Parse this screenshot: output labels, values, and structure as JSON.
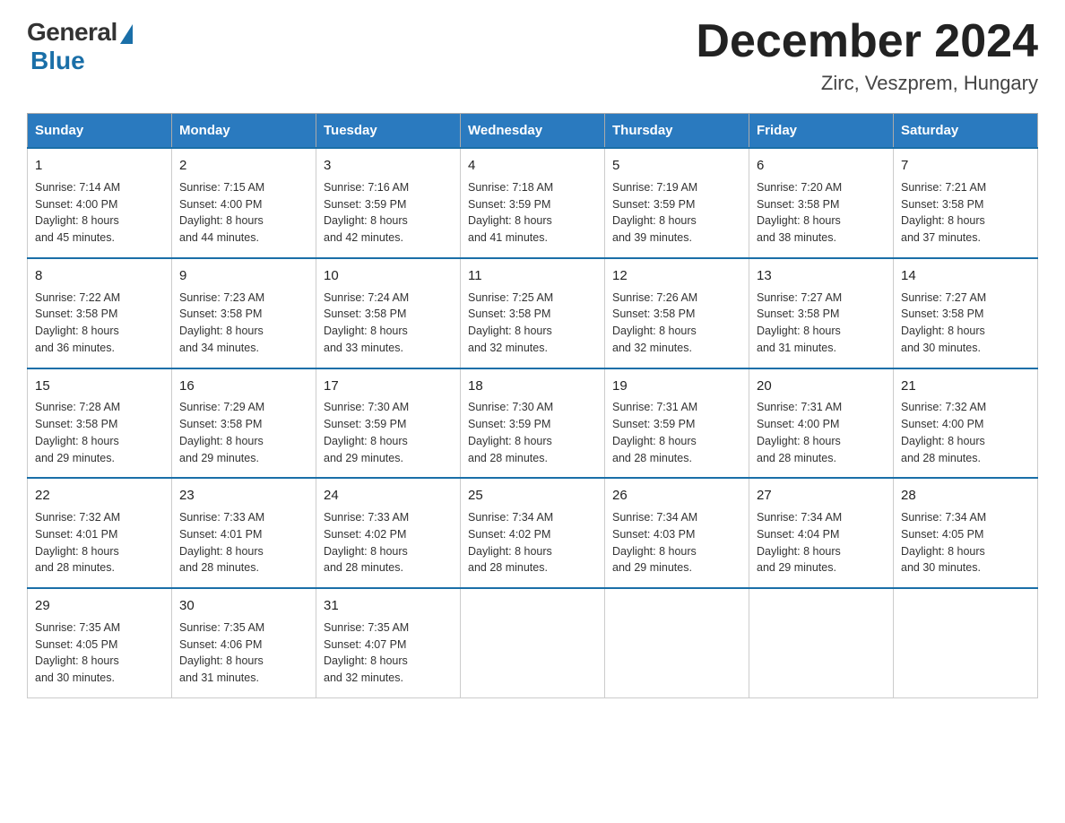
{
  "header": {
    "logo_general": "General",
    "logo_blue": "Blue",
    "month_title": "December 2024",
    "location": "Zirc, Veszprem, Hungary"
  },
  "days_of_week": [
    "Sunday",
    "Monday",
    "Tuesday",
    "Wednesday",
    "Thursday",
    "Friday",
    "Saturday"
  ],
  "weeks": [
    [
      {
        "day": "1",
        "sunrise": "7:14 AM",
        "sunset": "4:00 PM",
        "daylight": "8 hours and 45 minutes."
      },
      {
        "day": "2",
        "sunrise": "7:15 AM",
        "sunset": "4:00 PM",
        "daylight": "8 hours and 44 minutes."
      },
      {
        "day": "3",
        "sunrise": "7:16 AM",
        "sunset": "3:59 PM",
        "daylight": "8 hours and 42 minutes."
      },
      {
        "day": "4",
        "sunrise": "7:18 AM",
        "sunset": "3:59 PM",
        "daylight": "8 hours and 41 minutes."
      },
      {
        "day": "5",
        "sunrise": "7:19 AM",
        "sunset": "3:59 PM",
        "daylight": "8 hours and 39 minutes."
      },
      {
        "day": "6",
        "sunrise": "7:20 AM",
        "sunset": "3:58 PM",
        "daylight": "8 hours and 38 minutes."
      },
      {
        "day": "7",
        "sunrise": "7:21 AM",
        "sunset": "3:58 PM",
        "daylight": "8 hours and 37 minutes."
      }
    ],
    [
      {
        "day": "8",
        "sunrise": "7:22 AM",
        "sunset": "3:58 PM",
        "daylight": "8 hours and 36 minutes."
      },
      {
        "day": "9",
        "sunrise": "7:23 AM",
        "sunset": "3:58 PM",
        "daylight": "8 hours and 34 minutes."
      },
      {
        "day": "10",
        "sunrise": "7:24 AM",
        "sunset": "3:58 PM",
        "daylight": "8 hours and 33 minutes."
      },
      {
        "day": "11",
        "sunrise": "7:25 AM",
        "sunset": "3:58 PM",
        "daylight": "8 hours and 32 minutes."
      },
      {
        "day": "12",
        "sunrise": "7:26 AM",
        "sunset": "3:58 PM",
        "daylight": "8 hours and 32 minutes."
      },
      {
        "day": "13",
        "sunrise": "7:27 AM",
        "sunset": "3:58 PM",
        "daylight": "8 hours and 31 minutes."
      },
      {
        "day": "14",
        "sunrise": "7:27 AM",
        "sunset": "3:58 PM",
        "daylight": "8 hours and 30 minutes."
      }
    ],
    [
      {
        "day": "15",
        "sunrise": "7:28 AM",
        "sunset": "3:58 PM",
        "daylight": "8 hours and 29 minutes."
      },
      {
        "day": "16",
        "sunrise": "7:29 AM",
        "sunset": "3:58 PM",
        "daylight": "8 hours and 29 minutes."
      },
      {
        "day": "17",
        "sunrise": "7:30 AM",
        "sunset": "3:59 PM",
        "daylight": "8 hours and 29 minutes."
      },
      {
        "day": "18",
        "sunrise": "7:30 AM",
        "sunset": "3:59 PM",
        "daylight": "8 hours and 28 minutes."
      },
      {
        "day": "19",
        "sunrise": "7:31 AM",
        "sunset": "3:59 PM",
        "daylight": "8 hours and 28 minutes."
      },
      {
        "day": "20",
        "sunrise": "7:31 AM",
        "sunset": "4:00 PM",
        "daylight": "8 hours and 28 minutes."
      },
      {
        "day": "21",
        "sunrise": "7:32 AM",
        "sunset": "4:00 PM",
        "daylight": "8 hours and 28 minutes."
      }
    ],
    [
      {
        "day": "22",
        "sunrise": "7:32 AM",
        "sunset": "4:01 PM",
        "daylight": "8 hours and 28 minutes."
      },
      {
        "day": "23",
        "sunrise": "7:33 AM",
        "sunset": "4:01 PM",
        "daylight": "8 hours and 28 minutes."
      },
      {
        "day": "24",
        "sunrise": "7:33 AM",
        "sunset": "4:02 PM",
        "daylight": "8 hours and 28 minutes."
      },
      {
        "day": "25",
        "sunrise": "7:34 AM",
        "sunset": "4:02 PM",
        "daylight": "8 hours and 28 minutes."
      },
      {
        "day": "26",
        "sunrise": "7:34 AM",
        "sunset": "4:03 PM",
        "daylight": "8 hours and 29 minutes."
      },
      {
        "day": "27",
        "sunrise": "7:34 AM",
        "sunset": "4:04 PM",
        "daylight": "8 hours and 29 minutes."
      },
      {
        "day": "28",
        "sunrise": "7:34 AM",
        "sunset": "4:05 PM",
        "daylight": "8 hours and 30 minutes."
      }
    ],
    [
      {
        "day": "29",
        "sunrise": "7:35 AM",
        "sunset": "4:05 PM",
        "daylight": "8 hours and 30 minutes."
      },
      {
        "day": "30",
        "sunrise": "7:35 AM",
        "sunset": "4:06 PM",
        "daylight": "8 hours and 31 minutes."
      },
      {
        "day": "31",
        "sunrise": "7:35 AM",
        "sunset": "4:07 PM",
        "daylight": "8 hours and 32 minutes."
      },
      null,
      null,
      null,
      null
    ]
  ],
  "labels": {
    "sunrise": "Sunrise:",
    "sunset": "Sunset:",
    "daylight": "Daylight:"
  }
}
